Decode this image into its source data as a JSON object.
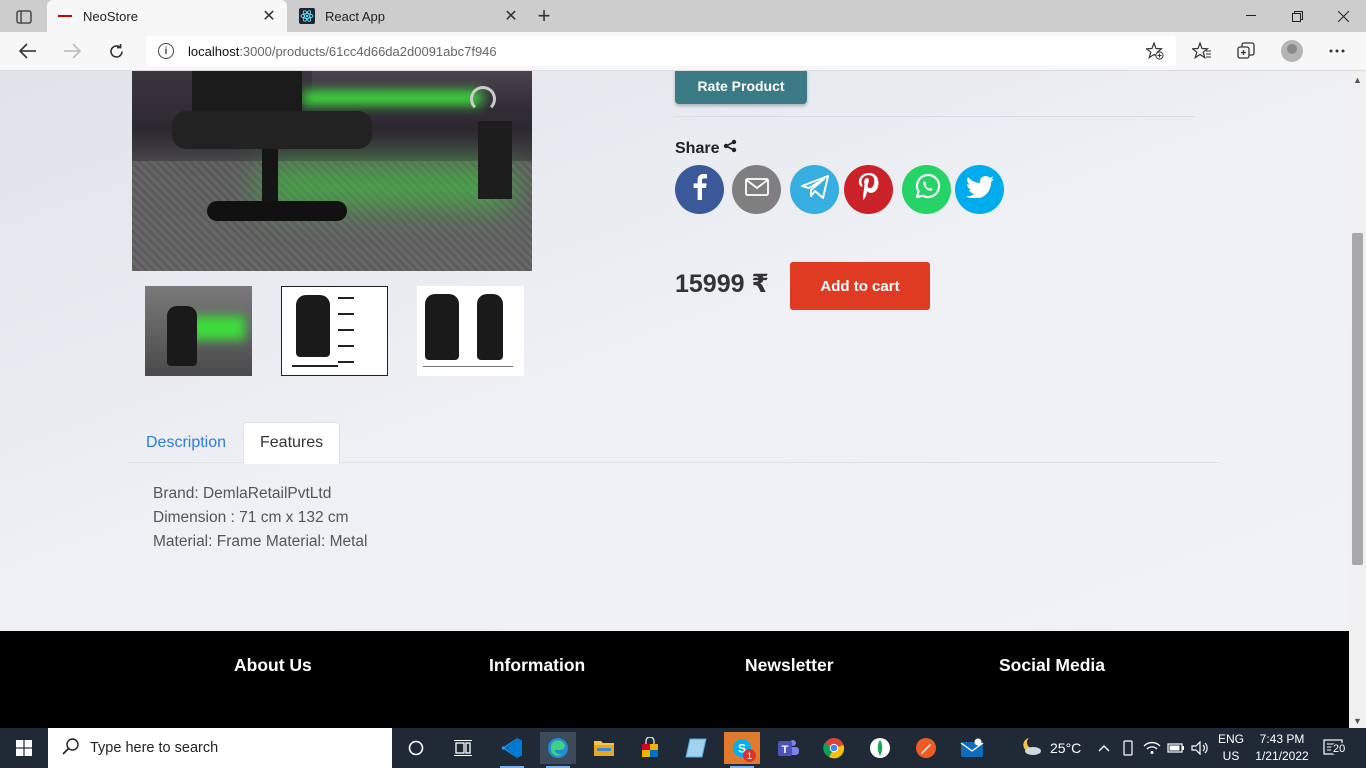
{
  "browser": {
    "tabs": [
      {
        "title": "NeoStore",
        "active": true
      },
      {
        "title": "React App",
        "active": false
      }
    ],
    "url_host": "localhost",
    "url_path": ":3000/products/61cc4d66da2d0091abc7f946"
  },
  "product": {
    "rate_button": "Rate Product",
    "share_label": "Share",
    "share_targets": [
      "facebook-icon",
      "email-icon",
      "telegram-icon",
      "pinterest-icon",
      "whatsapp-icon",
      "twitter-icon"
    ],
    "price": "15999 ₹",
    "add_to_cart": "Add to cart",
    "tabs": [
      {
        "label": "Description",
        "active": false
      },
      {
        "label": "Features",
        "active": true
      }
    ],
    "features": [
      "Brand: DemlaRetailPvtLtd",
      "Dimension : 71 cm x 132 cm",
      "Material: Frame Material: Metal"
    ]
  },
  "footer": {
    "columns": [
      "About Us",
      "Information",
      "Newsletter",
      "Social Media"
    ]
  },
  "colors": {
    "rate_button": "#3a7a84",
    "add_to_cart": "#df3a22",
    "description_tab_link": "#2d7ee0",
    "footer_bg": "#000000"
  },
  "taskbar": {
    "search_placeholder": "Type here to search",
    "temperature": "25°C",
    "language": "ENG",
    "region": "US",
    "time": "7:43 PM",
    "date": "1/21/2022",
    "notification_count": "20",
    "skype_badge": "1"
  }
}
